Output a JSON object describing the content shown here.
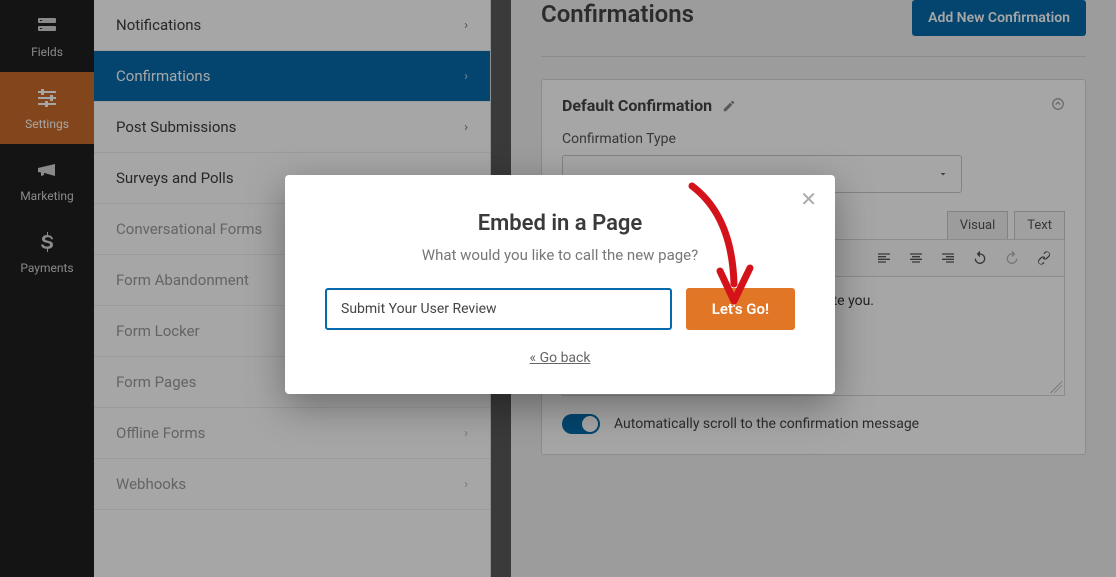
{
  "rail": {
    "items": [
      {
        "label": "Fields",
        "icon": "fields-icon"
      },
      {
        "label": "Settings",
        "icon": "settings-icon",
        "active": true
      },
      {
        "label": "Marketing",
        "icon": "megaphone-icon"
      },
      {
        "label": "Payments",
        "icon": "dollar-icon"
      }
    ]
  },
  "sidebar": {
    "items": [
      {
        "label": "Notifications"
      },
      {
        "label": "Confirmations",
        "active": true
      },
      {
        "label": "Post Submissions"
      },
      {
        "label": "Surveys and Polls"
      },
      {
        "label": "Conversational Forms",
        "dim": true
      },
      {
        "label": "Form Abandonment",
        "dim": true
      },
      {
        "label": "Form Locker",
        "dim": true
      },
      {
        "label": "Form Pages",
        "dim": true
      },
      {
        "label": "Offline Forms",
        "dim": true
      },
      {
        "label": "Webhooks",
        "dim": true
      }
    ]
  },
  "main": {
    "title": "Confirmations",
    "add_button": "Add New Confirmation",
    "panel": {
      "title": "Default Confirmation",
      "conf_type_label": "Confirmation Type",
      "tabs": {
        "visual": "Visual",
        "text": "Text"
      },
      "editor_text": "iate you.",
      "toggle_label": "Automatically scroll to the confirmation message"
    }
  },
  "modal": {
    "title": "Embed in a Page",
    "subtitle": "What would you like to call the new page?",
    "input_value": "Submit Your User Review",
    "go_label": "Let's Go!",
    "back_label": "« Go back"
  }
}
